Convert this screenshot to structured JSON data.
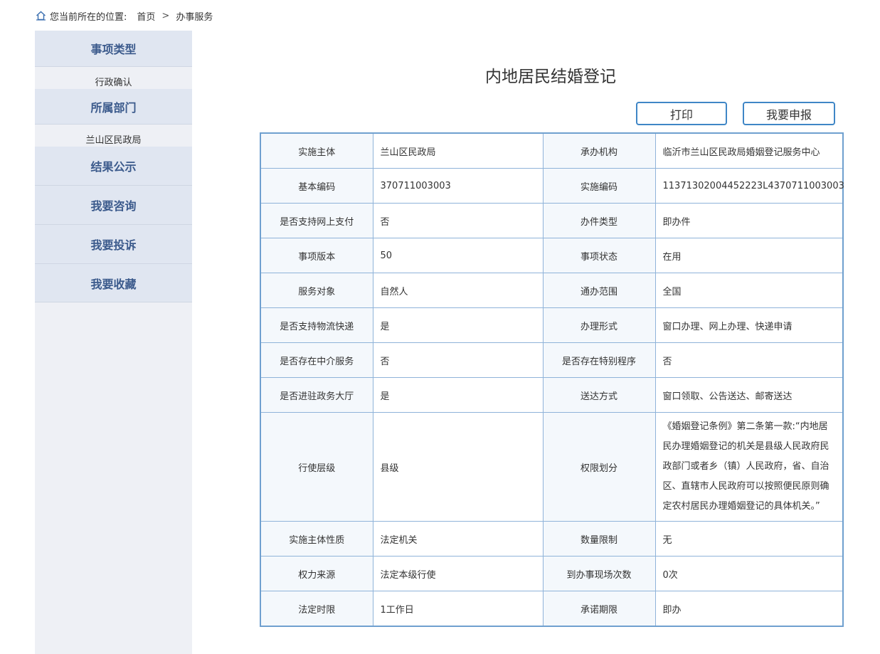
{
  "breadcrumb": {
    "prefix": "您当前所在的位置:",
    "home": "首页",
    "separator": ">",
    "current": "办事服务"
  },
  "sidebar": {
    "type_heading": "事项类型",
    "type_value": "行政确认",
    "dept_heading": "所属部门",
    "dept_value": "兰山区民政局",
    "menu": [
      "结果公示",
      "我要咨询",
      "我要投诉",
      "我要收藏"
    ]
  },
  "title": "内地居民结婚登记",
  "buttons": {
    "print": "打印",
    "apply": "我要申报"
  },
  "rows": [
    [
      {
        "label": "实施主体",
        "value": "兰山区民政局"
      },
      {
        "label": "承办机构",
        "value": "临沂市兰山区民政局婚姻登记服务中心"
      }
    ],
    [
      {
        "label": "基本编码",
        "value": "370711003003"
      },
      {
        "label": "实施编码",
        "value": "11371302004452223L4370711003003"
      }
    ],
    [
      {
        "label": "是否支持网上支付",
        "value": "否"
      },
      {
        "label": "办件类型",
        "value": "即办件"
      }
    ],
    [
      {
        "label": "事项版本",
        "value": "50"
      },
      {
        "label": "事项状态",
        "value": "在用"
      }
    ],
    [
      {
        "label": "服务对象",
        "value": "自然人"
      },
      {
        "label": "通办范围",
        "value": "全国"
      }
    ],
    [
      {
        "label": "是否支持物流快递",
        "value": "是"
      },
      {
        "label": "办理形式",
        "value": "窗口办理、网上办理、快递申请"
      }
    ],
    [
      {
        "label": "是否存在中介服务",
        "value": "否"
      },
      {
        "label": "是否存在特别程序",
        "value": "否"
      }
    ],
    [
      {
        "label": "是否进驻政务大厅",
        "value": "是"
      },
      {
        "label": "送达方式",
        "value": "窗口领取、公告送达、邮寄送达"
      }
    ],
    [
      {
        "label": "行使层级",
        "value": "县级"
      },
      {
        "label": "权限划分",
        "value": "《婚姻登记条例》第二条第一款:“内地居民办理婚姻登记的机关是县级人民政府民政部门或者乡（镇）人民政府，省、自治区、直辖市人民政府可以按照便民原则确定农村居民办理婚姻登记的具体机关。”"
      }
    ],
    [
      {
        "label": "实施主体性质",
        "value": "法定机关"
      },
      {
        "label": "数量限制",
        "value": "无"
      }
    ],
    [
      {
        "label": "权力来源",
        "value": "法定本级行使"
      },
      {
        "label": "到办事现场次数",
        "value": "0次"
      }
    ],
    [
      {
        "label": "法定时限",
        "value": "1工作日"
      },
      {
        "label": "承诺期限",
        "value": "即办"
      }
    ]
  ]
}
